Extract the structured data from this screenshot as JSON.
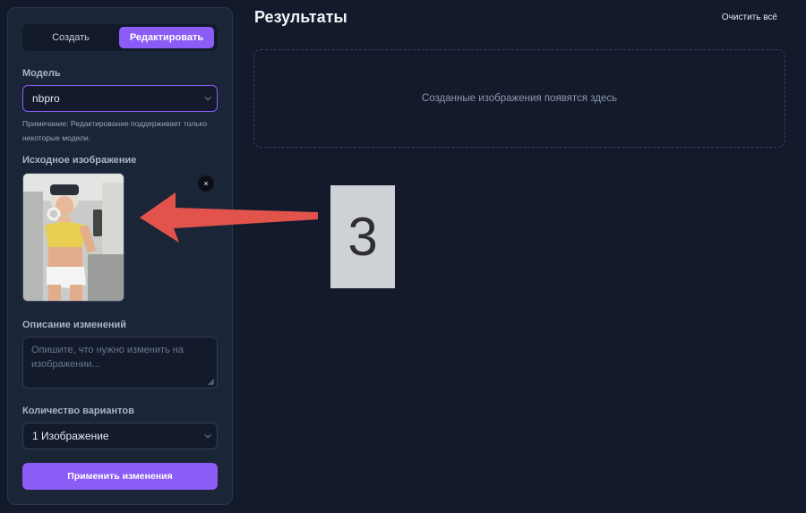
{
  "tabs": {
    "create": "Создать",
    "edit": "Редактировать"
  },
  "model": {
    "label": "Модель",
    "value": "nbpro",
    "note": "Примечание: Редактирование поддерживает только некоторые модели."
  },
  "source_image": {
    "label": "Исходное изображение",
    "close": "×"
  },
  "description": {
    "label": "Описание изменений",
    "placeholder": "Опишите, что нужно изменить на изображении..."
  },
  "variants": {
    "label": "Количество вариантов",
    "value": "1 Изображение"
  },
  "apply_button": "Применить изменения",
  "results": {
    "title": "Результаты",
    "clear": "Очистить всё",
    "empty": "Созданные изображения появятся здесь"
  },
  "annotation": {
    "number": "3",
    "arrow_color": "#e2544b"
  },
  "colors": {
    "accent": "#8b5cf6",
    "background": "#121a2c",
    "panel": "#1b2538"
  }
}
